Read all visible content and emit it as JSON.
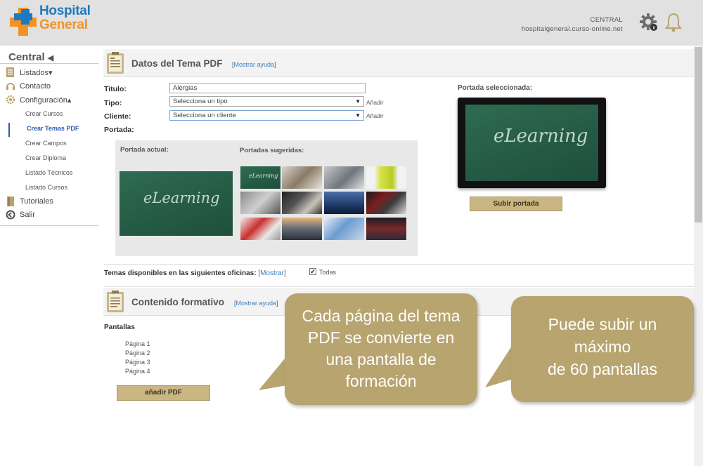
{
  "header": {
    "logo_line1": "Hospital",
    "logo_line2": "General",
    "site_name": "CENTRAL",
    "site_domain": "hospitalgeneral.curso-online.net",
    "icons": [
      "settings-gear-icon",
      "bell-icon"
    ]
  },
  "sidebar": {
    "title": "Central",
    "title_arrow": "◀",
    "items": [
      {
        "label": "Listados▾",
        "icon": "list-icon"
      },
      {
        "label": "Contacto",
        "icon": "headset-icon"
      },
      {
        "label": "Configuración▴",
        "icon": "gear-icon"
      },
      {
        "label": "Tutoriales",
        "icon": "book-icon"
      },
      {
        "label": "Salir",
        "icon": "exit-icon"
      }
    ],
    "subitems": [
      "Crear Cursos",
      "Crear Temas PDF",
      "Crear Campos",
      "Crear Diploma",
      "Listado Técnicos",
      "Listado Cursos"
    ]
  },
  "pdf_section": {
    "title": "Datos del Tema PDF",
    "help_open": "[",
    "help_link": "Mostrar ayuda",
    "help_close": "]",
    "titulo_label": "Titulo:",
    "titulo_value": "Alergias",
    "tipo_label": "Tipo:",
    "tipo_value": "Selecciona un tipo",
    "cliente_label": "Cliente:",
    "cliente_value": "Selecciona un cliente",
    "add_label": "Añadir",
    "portada_label": "Portada:",
    "portada_actual_label": "Portada actual:",
    "portadas_sugeridas_label": "Portadas sugeridas:",
    "portada_seleccionada_label": "Portada seleccionada:",
    "cover_text": "eLearning",
    "subir_portada_label": "Subir portada"
  },
  "offices": {
    "label": "Temas disponibles en las siguientes oficinas:",
    "show_link": "Mostrar",
    "todas_label": "Todas",
    "todas_checked": true
  },
  "content_section": {
    "title": "Contenido formativo",
    "help_open": "[",
    "help_link": "Mostrar ayuda",
    "help_close": "]",
    "pantallas_label": "Pantallas",
    "pages": [
      "Página 1",
      "Página 2",
      "Página 3",
      "Página 4"
    ],
    "add_pdf_label": "añadir PDF"
  },
  "callouts": {
    "left": [
      "Cada página del tema",
      "PDF se convierte en",
      "una pantalla de",
      "formación"
    ],
    "right": [
      "Puede subir un",
      "máximo",
      "de 60 pantallas"
    ]
  },
  "colors": {
    "accent_gold": "#c9b682",
    "callout_gold": "#b8a46f",
    "link_blue": "#3a80c2",
    "chalkboard_green": "#2a6149"
  }
}
